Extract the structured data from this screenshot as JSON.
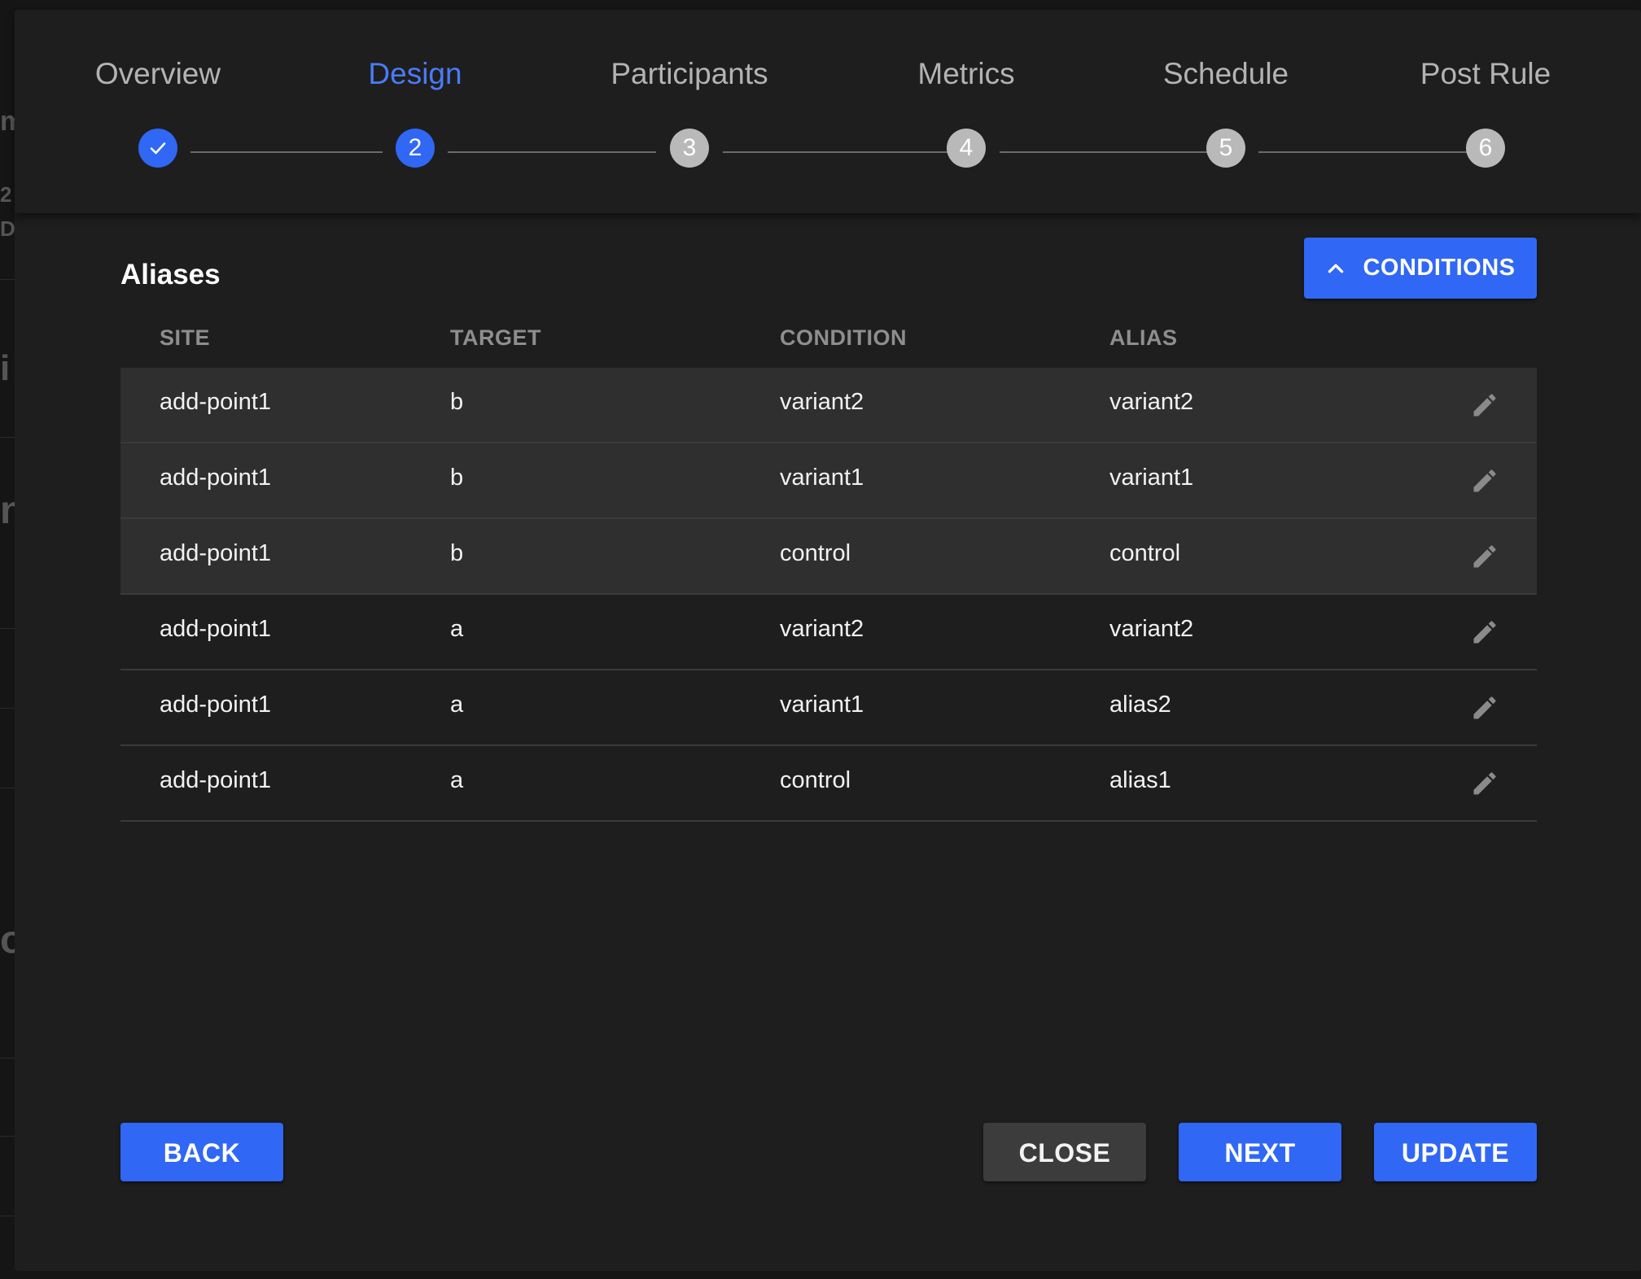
{
  "stepper": {
    "steps": [
      {
        "label": "Overview",
        "number": "1",
        "state": "done"
      },
      {
        "label": "Design",
        "number": "2",
        "state": "active"
      },
      {
        "label": "Participants",
        "number": "3",
        "state": "pending"
      },
      {
        "label": "Metrics",
        "number": "4",
        "state": "pending"
      },
      {
        "label": "Schedule",
        "number": "5",
        "state": "pending"
      },
      {
        "label": "Post Rule",
        "number": "6",
        "state": "pending"
      }
    ]
  },
  "aliases": {
    "title": "Aliases",
    "conditions_button_label": "CONDITIONS",
    "columns": {
      "site": "SITE",
      "target": "TARGET",
      "condition": "CONDITION",
      "alias": "ALIAS"
    },
    "rows": [
      {
        "site": "add-point1",
        "target": "b",
        "condition": "variant2",
        "alias": "variant2"
      },
      {
        "site": "add-point1",
        "target": "b",
        "condition": "variant1",
        "alias": "variant1"
      },
      {
        "site": "add-point1",
        "target": "b",
        "condition": "control",
        "alias": "control"
      },
      {
        "site": "add-point1",
        "target": "a",
        "condition": "variant2",
        "alias": "variant2"
      },
      {
        "site": "add-point1",
        "target": "a",
        "condition": "variant1",
        "alias": "alias2"
      },
      {
        "site": "add-point1",
        "target": "a",
        "condition": "control",
        "alias": "alias1"
      }
    ]
  },
  "footer": {
    "back_label": "BACK",
    "close_label": "CLOSE",
    "next_label": "NEXT",
    "update_label": "UPDATE"
  },
  "colors": {
    "accent": "#3067f5",
    "active_step_text": "#4a7bf7",
    "modal_bg": "#1e1e1e",
    "shaded_row_bg": "#2f2f2f"
  },
  "icons": {
    "step_done": "check-icon",
    "conditions_toggle": "chevron-up-icon",
    "row_action": "pencil-icon"
  }
}
